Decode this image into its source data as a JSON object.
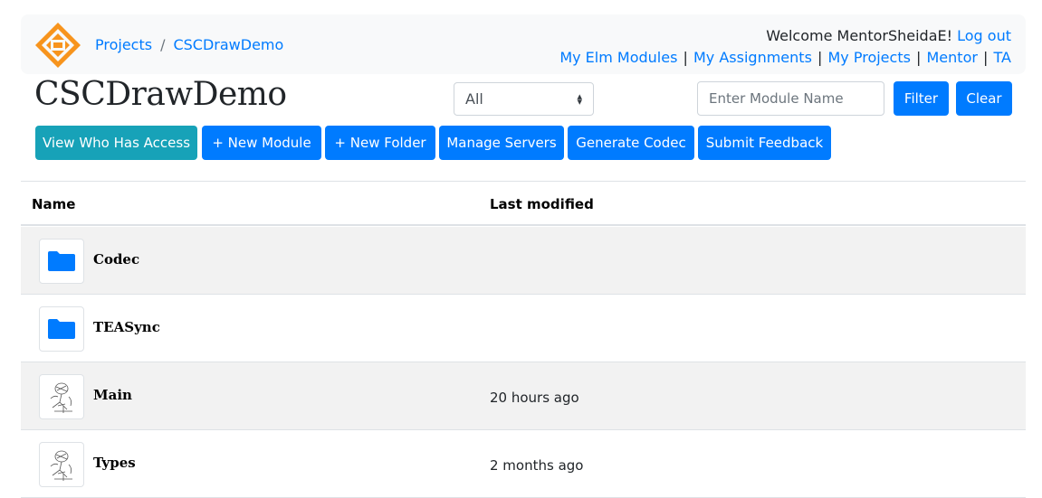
{
  "breadcrumb": {
    "projects": "Projects",
    "separator": "/",
    "current": "CSCDrawDemo"
  },
  "user": {
    "welcome": "Welcome MentorSheidaE!",
    "logout": "Log out",
    "nav": [
      "My Elm Modules",
      "My Assignments",
      "My Projects",
      "Mentor",
      "TA"
    ],
    "nav_separator": "|"
  },
  "page": {
    "title": "CSCDrawDemo"
  },
  "filter": {
    "select_value": "All",
    "search_placeholder": "Enter Module Name",
    "filter_label": "Filter",
    "clear_label": "Clear"
  },
  "actions": {
    "view_access": "View Who Has Access",
    "new_module": "+ New Module",
    "new_folder": "+ New Folder",
    "manage_servers": "Manage Servers",
    "generate_codec": "Generate Codec",
    "submit_feedback": "Submit Feedback"
  },
  "table": {
    "headers": {
      "name": "Name",
      "modified": "Last modified"
    },
    "rows": [
      {
        "name": "Codec",
        "modified": "",
        "icon": "folder-icon"
      },
      {
        "name": "TEASync",
        "modified": "",
        "icon": "folder-icon"
      },
      {
        "name": "Main",
        "modified": "20 hours ago",
        "icon": "module-sketch-icon"
      },
      {
        "name": "Types",
        "modified": "2 months ago",
        "icon": "module-sketch-icon"
      }
    ]
  },
  "colors": {
    "primary": "#007bff",
    "info": "#17a2b8",
    "logo": "#f7941d"
  }
}
